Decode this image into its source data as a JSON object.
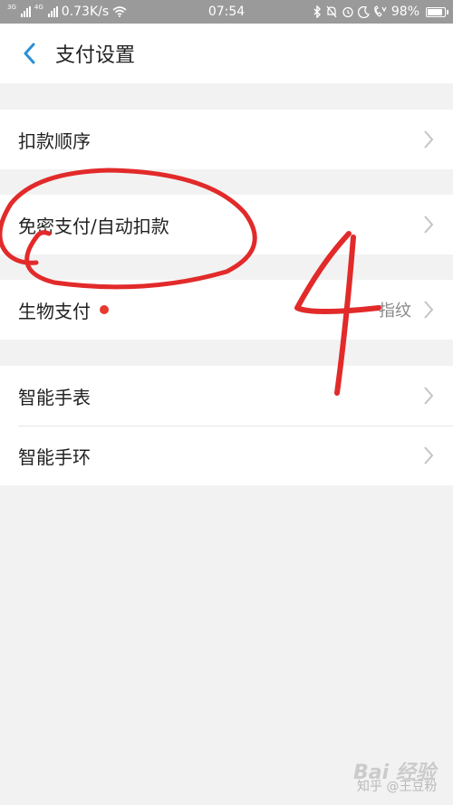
{
  "status_bar": {
    "network_type_1": "3G",
    "network_type_2": "4G",
    "speed": "0.73K/s",
    "time": "07:54",
    "battery": "98%"
  },
  "header": {
    "title": "支付设置"
  },
  "groups": [
    {
      "rows": [
        {
          "label": "扣款顺序"
        }
      ]
    },
    {
      "rows": [
        {
          "label": "免密支付/自动扣款"
        }
      ]
    },
    {
      "rows": [
        {
          "label": "生物支付",
          "value": "指纹",
          "has_red_dot": true
        }
      ]
    },
    {
      "rows": [
        {
          "label": "智能手表"
        },
        {
          "label": "智能手环"
        }
      ]
    }
  ],
  "annotation": {
    "number": "4",
    "color": "#e22a2a"
  },
  "watermarks": {
    "zhihu": "知乎 @王豆粉",
    "baidu": "Bai 经验"
  },
  "colors": {
    "accent": "#2a8fd6",
    "status_bar": "#9a9a9a",
    "red_dot": "#e63a2e"
  }
}
